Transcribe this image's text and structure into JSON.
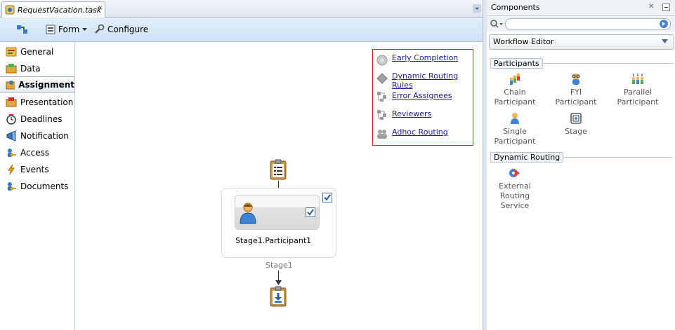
{
  "editor": {
    "tab_title": "RequestVacation.task",
    "close_glyph": "✕"
  },
  "toolbar": {
    "form_label": "Form",
    "configure_label": "Configure"
  },
  "nav": {
    "items": [
      {
        "label": "General",
        "icon": "general-icon"
      },
      {
        "label": "Data",
        "icon": "data-icon"
      },
      {
        "label": "Assignment",
        "icon": "assignment-icon",
        "active": true
      },
      {
        "label": "Presentation",
        "icon": "presentation-icon"
      },
      {
        "label": "Deadlines",
        "icon": "deadlines-icon"
      },
      {
        "label": "Notification",
        "icon": "notification-icon"
      },
      {
        "label": "Access",
        "icon": "access-icon"
      },
      {
        "label": "Events",
        "icon": "events-icon"
      },
      {
        "label": "Documents",
        "icon": "documents-icon"
      }
    ]
  },
  "canvas": {
    "links": [
      {
        "label": "Early Completion",
        "icon": "early-completion-icon"
      },
      {
        "label": "Dynamic Routing Rules",
        "icon": "diamond-icon"
      },
      {
        "label": "Error Assignees",
        "icon": "hierarchy-icon"
      },
      {
        "label": "Reviewers",
        "icon": "hierarchy-icon"
      },
      {
        "label": "Adhoc Routing",
        "icon": "group-icon"
      }
    ],
    "participant_label": "Stage1.Participant1",
    "stage_label": "Stage1"
  },
  "components": {
    "title": "Components",
    "editor_select_value": "Workflow Editor",
    "sections": [
      {
        "title": "Participants",
        "items": [
          {
            "label": "Chain\nParticipant",
            "icon": "chain-participant-icon"
          },
          {
            "label": "FYI\nParticipant",
            "icon": "fyi-participant-icon"
          },
          {
            "label": "Parallel\nParticipant",
            "icon": "parallel-participant-icon"
          },
          {
            "label": "Single\nParticipant",
            "icon": "single-participant-icon"
          },
          {
            "label": "Stage",
            "icon": "stage-icon"
          }
        ]
      },
      {
        "title": "Dynamic Routing",
        "items": [
          {
            "label": "External\nRouting\nService",
            "icon": "external-routing-icon"
          }
        ]
      }
    ]
  },
  "colors": {
    "link": "#1a1aa6",
    "link_box_border": "#e02020",
    "toolbar_bg": "#d6e7f8",
    "checkbox_border": "#5776a3"
  }
}
